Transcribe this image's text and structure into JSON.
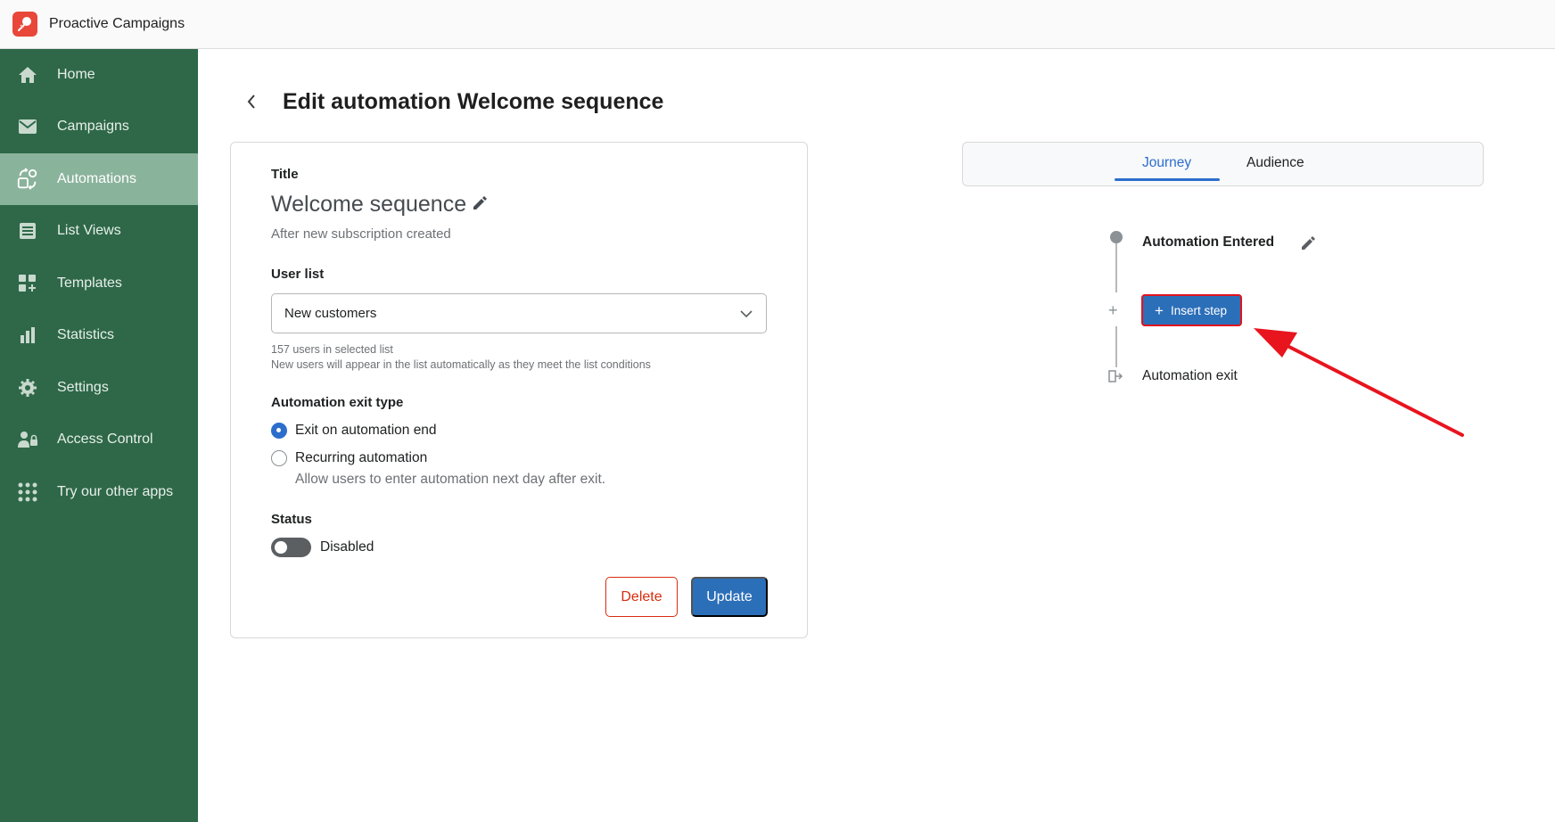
{
  "app": {
    "title": "Proactive Campaigns",
    "logo_icon": "rocket-icon"
  },
  "sidebar": {
    "items": [
      {
        "label": "Home",
        "icon": "home-icon"
      },
      {
        "label": "Campaigns",
        "icon": "mail-icon"
      },
      {
        "label": "Automations",
        "icon": "automation-icon",
        "active": true
      },
      {
        "label": "List Views",
        "icon": "list-icon"
      },
      {
        "label": "Templates",
        "icon": "templates-icon"
      },
      {
        "label": "Statistics",
        "icon": "bar-chart-icon"
      },
      {
        "label": "Settings",
        "icon": "gear-icon"
      },
      {
        "label": "Access Control",
        "icon": "user-lock-icon"
      },
      {
        "label": "Try our other apps",
        "icon": "apps-grid-icon"
      }
    ]
  },
  "header": {
    "prefix": "Edit automation",
    "name": "Welcome sequence"
  },
  "form": {
    "title_label": "Title",
    "title_value": "Welcome sequence",
    "trigger_text": "After new subscription created",
    "user_list_label": "User list",
    "user_list_value": "New customers",
    "user_count_text": "157 users in selected list",
    "user_list_help": "New users will appear in the list automatically as they meet the list conditions",
    "exit_type_label": "Automation exit type",
    "exit_options": [
      {
        "label": "Exit on automation end",
        "selected": true
      },
      {
        "label": "Recurring automation",
        "selected": false
      }
    ],
    "recurring_help": "Allow users to enter automation next day after exit.",
    "status_label": "Status",
    "status_value": "Disabled",
    "delete_label": "Delete",
    "update_label": "Update"
  },
  "journey": {
    "tabs": [
      {
        "label": "Journey",
        "active": true
      },
      {
        "label": "Audience",
        "active": false
      }
    ],
    "entered_label": "Automation Entered",
    "insert_label": "Insert step",
    "exit_label": "Automation exit"
  },
  "colors": {
    "sidebar_bg": "#2e6848",
    "sidebar_active": "#8ab39b",
    "primary": "#2c6fb9",
    "danger": "#d72c0d",
    "annotation_red": "#e0141e"
  }
}
